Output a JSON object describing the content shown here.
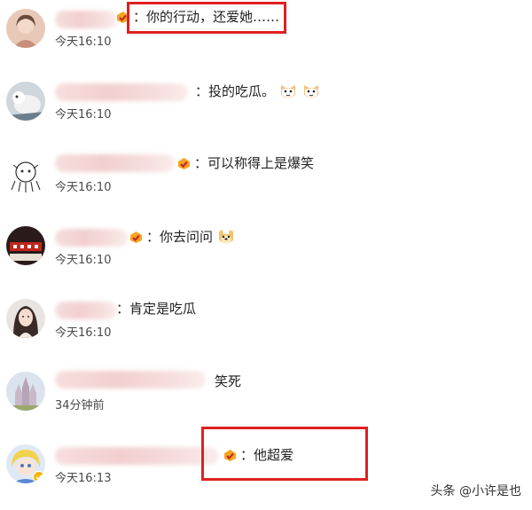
{
  "comments": [
    {
      "text": "：你的行动，还爱她……",
      "time": "今天16:10",
      "emoji": []
    },
    {
      "text": "：投的吃瓜。",
      "time": "今天16:10",
      "emoji": [
        "cat-emoji",
        "cat-emoji"
      ]
    },
    {
      "text": "：可以称得上是爆笑",
      "time": "今天16:10",
      "emoji": []
    },
    {
      "text": "：你去问问",
      "time": "今天16:10",
      "emoji": [
        "doge-emoji"
      ]
    },
    {
      "text": "：肯定是吃瓜",
      "time": "今天16:10",
      "emoji": []
    },
    {
      "text": "笑死",
      "time": "34分钟前",
      "emoji": []
    },
    {
      "text": "：他超爱",
      "time": "今天16:13",
      "emoji": []
    }
  ],
  "watermark": "头条 @小许是也",
  "colors": {
    "highlight": "#e02020",
    "time_text": "#4a4a4a",
    "name_blur": "#f2cfcf"
  }
}
